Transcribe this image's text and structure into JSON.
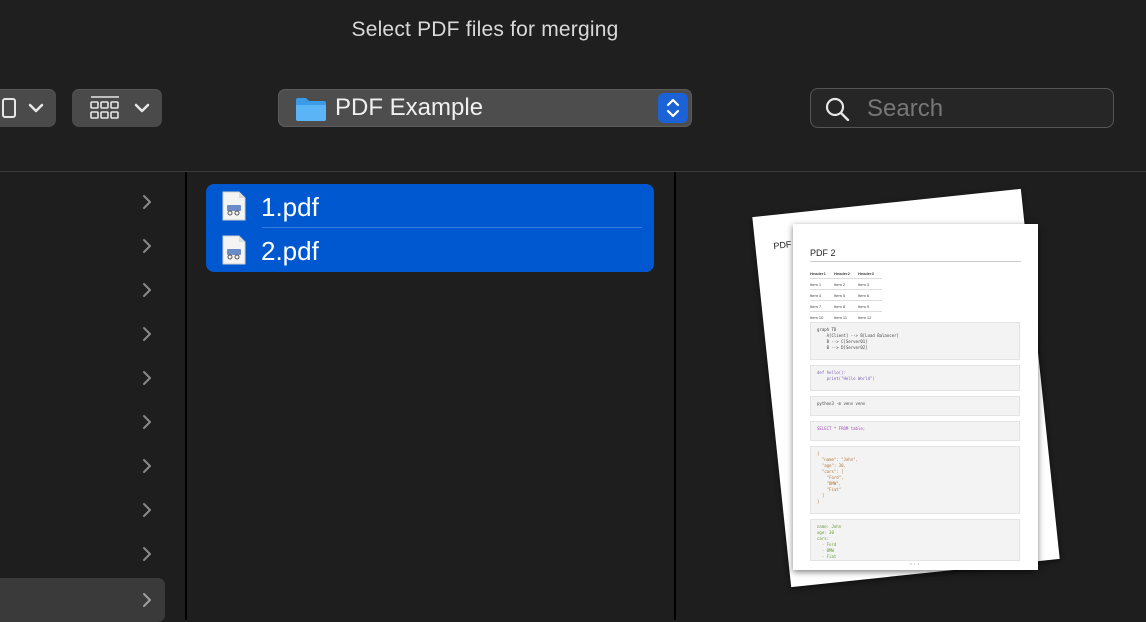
{
  "window": {
    "title": "Select PDF files for merging"
  },
  "toolbar": {
    "sidebar_icon": "sidebar-icon",
    "view_icon": "grid-view-icon",
    "location": {
      "label": "PDF Example",
      "icon": "folder-icon"
    },
    "search": {
      "placeholder": "Search",
      "value": ""
    }
  },
  "left_column": {
    "row_count": 10,
    "selected_row": 9
  },
  "files": [
    {
      "name": "1.pdf",
      "icon": "pdf-file-icon",
      "selected": true
    },
    {
      "name": "2.pdf",
      "icon": "pdf-file-icon",
      "selected": true
    }
  ],
  "preview": {
    "front_page_title": "PDF 2",
    "back_page_title": "PDF",
    "table_headers": [
      "Header1",
      "Header2",
      "Header3"
    ],
    "table_rows": [
      [
        "Item 1",
        "Item 2",
        "Item 3"
      ],
      [
        "Item 4",
        "Item 5",
        "Item 6"
      ],
      [
        "Item 7",
        "Item 8",
        "Item 9"
      ],
      [
        "Item 10",
        "Item 11",
        "Item 12"
      ]
    ],
    "code_blocks": [
      "graph TD\n    A[Client] --> B[Load Balancer]\n    B --> C[Server01]\n    B --> D[Server02]",
      "def hello():\n    print(\"Hello World\")",
      "python3 -m venv venv",
      "SELECT * FROM table;",
      "{\n  \"name\": \"John\",\n  \"age\": 30,\n  \"cars\": [\n    \"Ford\",\n    \"BMW\",\n    \"Fiat\"\n  ]\n}",
      "name: John\nage: 30\ncars:\n  - Ford\n  - BMW\n  - Fiat"
    ],
    "page_footer": "1 / 1"
  },
  "colors": {
    "selection": "#0058d1",
    "accent": "#1a62d6"
  }
}
